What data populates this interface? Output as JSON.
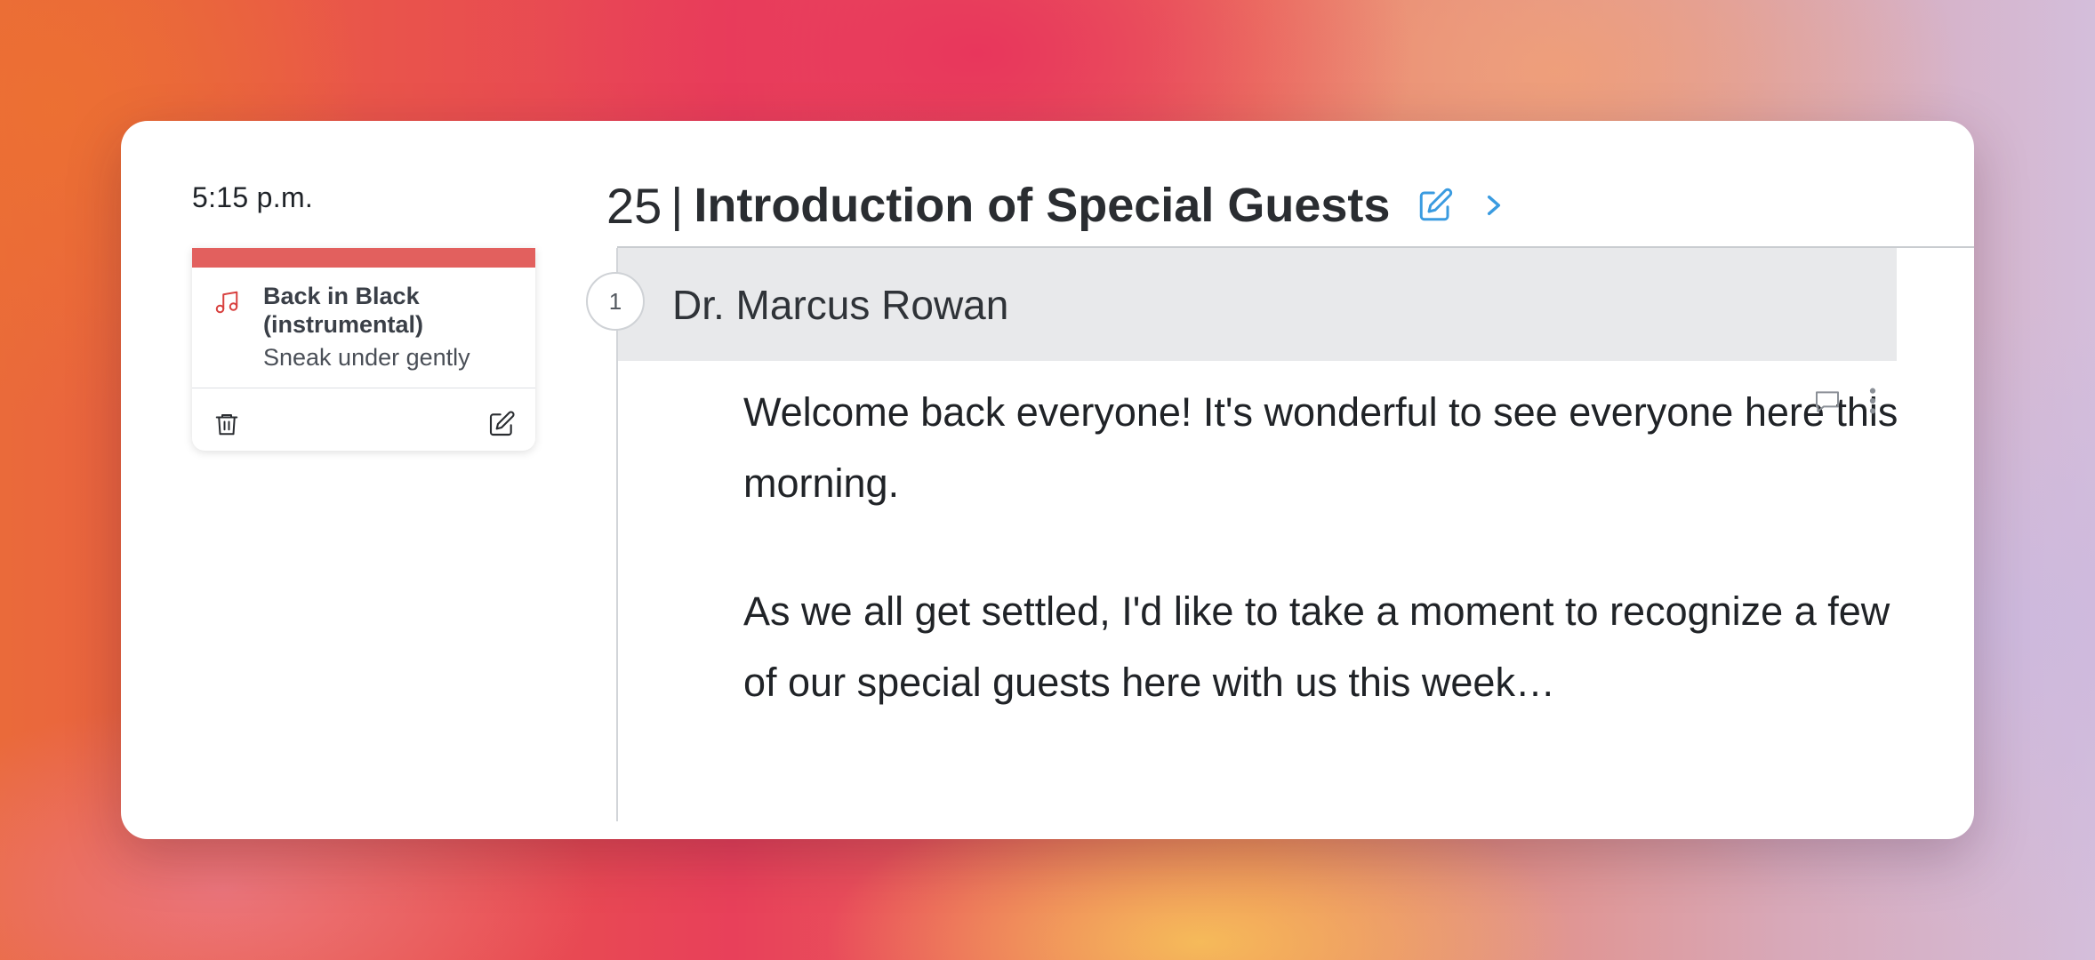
{
  "schedule": {
    "time": "5:15 p.m."
  },
  "segment": {
    "number": "25",
    "separator": "|",
    "title": "Introduction of Special Guests",
    "edit_icon": "pencil-square-icon",
    "next_icon": "chevron-right-icon"
  },
  "cue": {
    "accent_color": "#e2605e",
    "icon": "music-note-icon",
    "title": "Back in Black (instrumental)",
    "note": "Sneak under gently",
    "delete_icon": "trash-icon",
    "edit_icon": "pencil-square-icon"
  },
  "script": {
    "speaker_number": "1",
    "speaker_name": "Dr. Marcus Rowan",
    "paragraphs": [
      "Welcome back everyone! It's wonderful to see everyone here this morning.",
      "As we all get settled, I'd like to take a moment to recognize a few of our special guests here with us this week…"
    ],
    "comment_icon": "comment-icon",
    "more_icon": "more-vertical-icon"
  },
  "colors": {
    "link_blue": "#3a9be0",
    "cue_red": "#e2605e",
    "speaker_band": "#e8e9eb"
  }
}
